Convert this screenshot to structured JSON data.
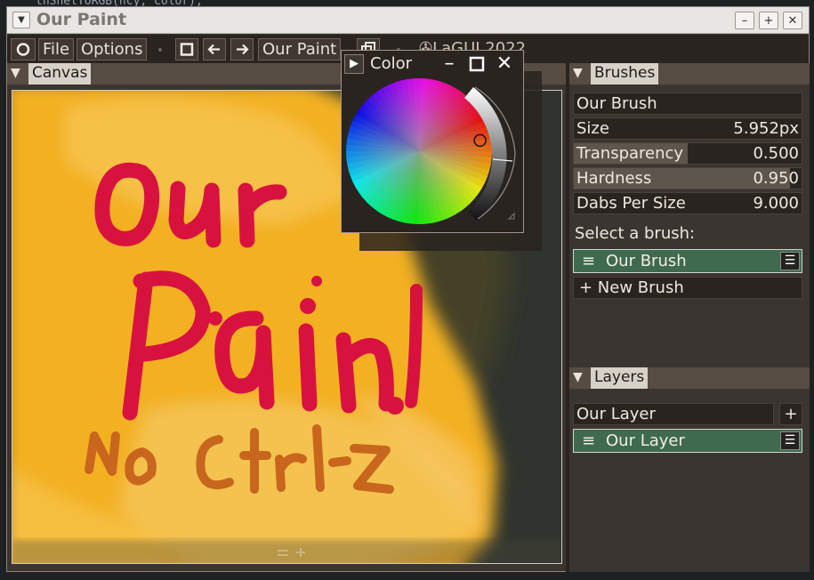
{
  "background_code": "tnShelToRGB(hcy, color);",
  "window": {
    "title": "Our Paint",
    "menu_icon": "chevron-down-icon",
    "minimize_icon": "minimize-icon",
    "move_icon": "move-icon",
    "close_icon": "close-icon"
  },
  "menubar": {
    "file": "File",
    "options": "Options",
    "doc_name": "Our Paint",
    "credit": "LaGUI 2022"
  },
  "canvas": {
    "header": "Canvas",
    "painting_text": [
      "Our",
      "Paint!",
      "NO Ctrl-Z"
    ]
  },
  "color": {
    "header": "Color",
    "cursor": {
      "hue": 20,
      "saturation": 0.85
    }
  },
  "brushes": {
    "header": "Brushes",
    "name": "Our Brush",
    "properties": [
      {
        "label": "Size",
        "value": "5.952px",
        "fill": 0
      },
      {
        "label": "Transparency",
        "value": "0.500",
        "fill": 0.5
      },
      {
        "label": "Hardness",
        "value": "0.950",
        "fill": 0.95
      },
      {
        "label": "Dabs Per Size",
        "value": "9.000",
        "fill": 0
      }
    ],
    "select_label": "Select a brush:",
    "selected": "Our Brush",
    "new_brush": "+ New Brush"
  },
  "layers": {
    "header": "Layers",
    "name": "Our Layer",
    "add": "+",
    "selected": "Our Layer"
  },
  "colors": {
    "accent_green": "#3f6a50",
    "panel": "#3b3531",
    "paint_red": "#d8123f",
    "paint_orange": "#c8661d",
    "paint_yellow": "#f6b21c"
  }
}
